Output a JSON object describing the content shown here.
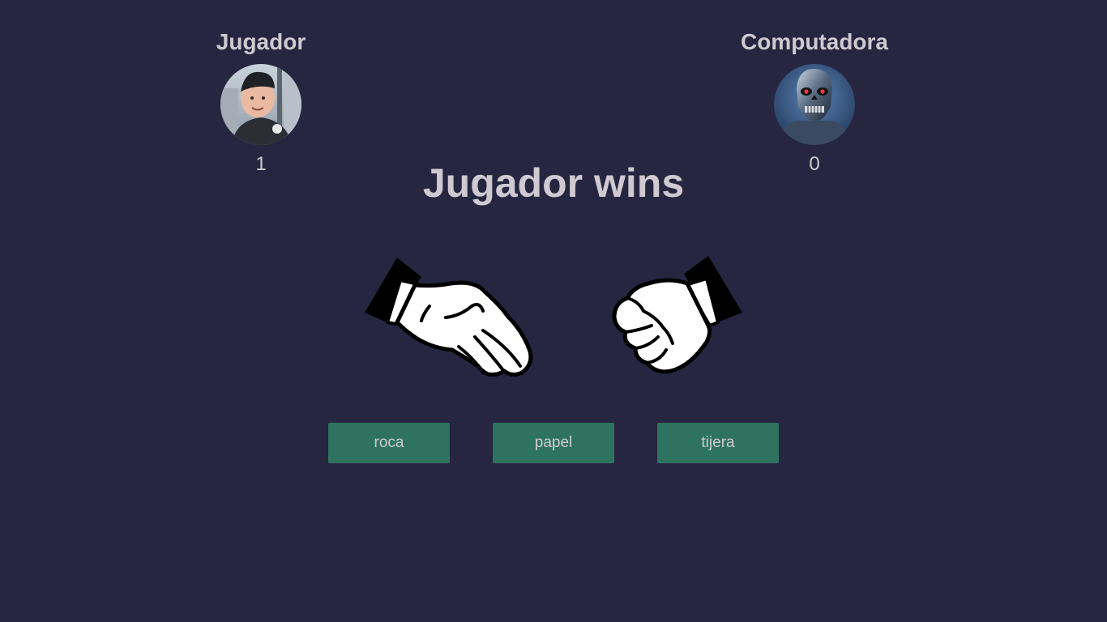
{
  "player": {
    "name": "Jugador",
    "score": "1",
    "avatar_icon": "boy-avatar",
    "hand_icon": "open-hand-paper-icon"
  },
  "computer": {
    "name": "Computadora",
    "score": "0",
    "avatar_icon": "robot-avatar",
    "hand_icon": "fist-rock-icon"
  },
  "result": {
    "text": "Jugador wins"
  },
  "choices": [
    {
      "label": "roca"
    },
    {
      "label": "papel"
    },
    {
      "label": "tijera"
    }
  ],
  "colors": {
    "background": "#262641",
    "text": "#cfcad1",
    "button": "#2e735f"
  }
}
